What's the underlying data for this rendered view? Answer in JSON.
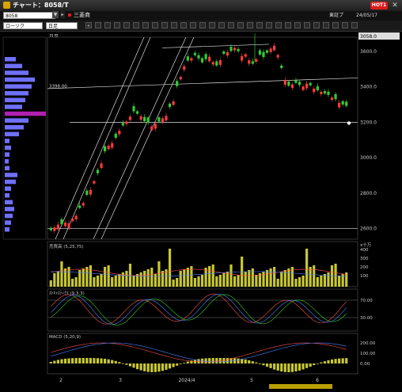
{
  "window": {
    "title": "チャート：8058/T",
    "hot_label": "HOT1",
    "close_glyph": "✕"
  },
  "info": {
    "code": "8058",
    "company": "三菱商",
    "market": "東証プ",
    "date": "24/05/17"
  },
  "toolbar": {
    "chart_type": "ローソク",
    "period": "日足",
    "buttons": [
      "+",
      "■",
      "■",
      "■",
      "■",
      "■",
      "■",
      "■",
      "■",
      "■",
      "■",
      "■",
      "■",
      "■",
      "■",
      "■",
      "■",
      "■",
      "■",
      "■",
      "■",
      "■",
      "■",
      "■",
      "■",
      "■",
      "■",
      "■",
      "■"
    ]
  },
  "panel_label": "日足",
  "price_panel": {
    "last_price_tag": "3058.0",
    "horizontal_line_label": "3398.00",
    "y_ticks": [
      "3600.0",
      "3400.0",
      "3200.0",
      "3000.0",
      "2800.0",
      "2600.0"
    ],
    "y_range": [
      2540,
      3680
    ]
  },
  "volume_panel": {
    "label": "売買高 (5,25,75)",
    "unit_label": "x十万",
    "y_ticks": [
      "400",
      "300",
      "200",
      "100"
    ]
  },
  "stoch_panel": {
    "label": "ｽﾄｷｬｽﾃｨｸｽ (9,3,3)",
    "y_ticks": [
      "70.00",
      "30.00"
    ]
  },
  "macd_panel": {
    "label": "MACD (5,20,9)",
    "y_ticks": [
      "200.00",
      "100.00",
      "0.00"
    ]
  },
  "x_axis": {
    "labels": [
      "2",
      "3",
      "2024/4",
      "5",
      "6"
    ]
  },
  "colors": {
    "up": "#ff3a3a",
    "down": "#33cc33",
    "volume": "#c8c832",
    "profile": "#7070ff",
    "profile_highlight": "#b020b0"
  },
  "chart_data": {
    "type": "candlestick",
    "series": [
      {
        "name": "price",
        "values": [
          2590,
          2606,
          2622,
          2624,
          2634,
          2630,
          2656,
          2672,
          2716,
          2744,
          2790,
          2818,
          2868,
          2912,
          2968,
          3036,
          3068,
          3082,
          3112,
          3152,
          3182,
          3204,
          3232,
          3262,
          3248,
          3234,
          3206,
          3198,
          3176,
          3190,
          3204,
          3222,
          3236,
          3286,
          3318,
          3404,
          3456,
          3516,
          3548,
          3562,
          3578,
          3560,
          3538,
          3556,
          3570,
          3540,
          3520,
          3550,
          3586,
          3596,
          3602,
          3620,
          3600,
          3574,
          3584,
          3550,
          3530,
          3556,
          3582,
          3568,
          3592,
          3616,
          3632,
          3580,
          3506,
          3438,
          3406,
          3414,
          3422,
          3410,
          3402,
          3418,
          3408,
          3390,
          3380,
          3372,
          3362,
          3354,
          3340,
          3330,
          3310,
          3300,
          3292
        ]
      }
    ]
  }
}
